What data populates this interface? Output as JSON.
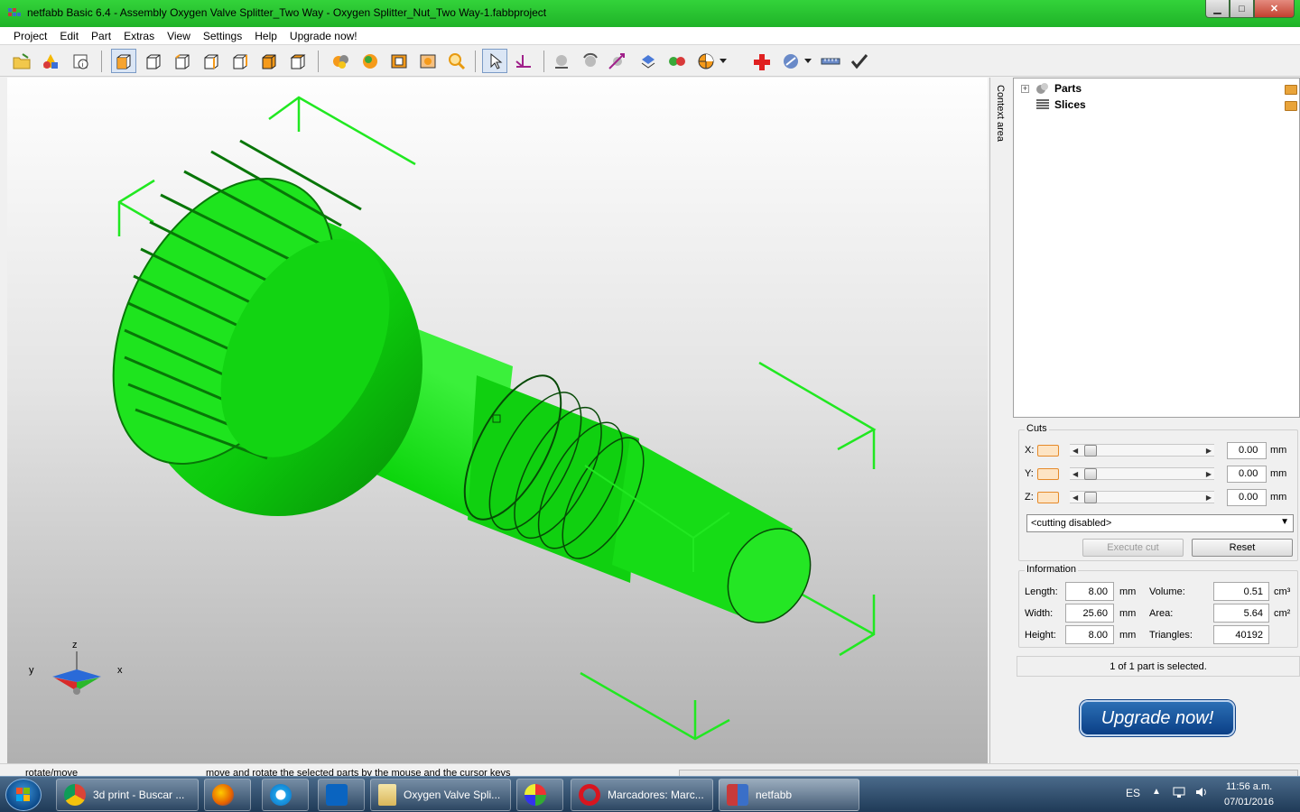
{
  "window": {
    "title": "netfabb Basic 6.4 - Assembly Oxygen Valve Splitter_Two Way - Oxygen Splitter_Nut_Two Way-1.fabbproject",
    "minimize": "▁",
    "maximize": "□",
    "close": "✕"
  },
  "menu": [
    "Project",
    "Edit",
    "Part",
    "Extras",
    "View",
    "Settings",
    "Help",
    "Upgrade now!"
  ],
  "toolbar_icons": [
    "open-project-icon",
    "add-part-icon",
    "project-info-icon",
    "view-default-icon",
    "view-front-icon",
    "view-back-icon",
    "view-left-icon",
    "view-right-icon",
    "view-top-icon",
    "view-bottom-icon",
    "repair-icon",
    "color-mode-icon",
    "wireframe-icon",
    "transparent-icon",
    "zoom-icon",
    "select-pointer-icon",
    "measure-icon",
    "sphere-icon",
    "rotate-icon",
    "scale-icon",
    "move-icon",
    "colors-icon",
    "section-icon",
    "add-icon",
    "analysis-icon",
    "ruler-icon",
    "checkmark-icon"
  ],
  "viewport": {
    "part_color": "#00d400",
    "bbox_color": "#21e821",
    "axis": {
      "x": "x",
      "y": "y",
      "z": "z"
    }
  },
  "context_strip_label": "Context area",
  "tree": {
    "items": [
      {
        "label": "Parts",
        "expand": "+"
      },
      {
        "label": "Slices"
      }
    ]
  },
  "cuts": {
    "title": "Cuts",
    "rows": [
      {
        "axis": "X:",
        "value": "0.00",
        "unit": "mm"
      },
      {
        "axis": "Y:",
        "value": "0.00",
        "unit": "mm"
      },
      {
        "axis": "Z:",
        "value": "0.00",
        "unit": "mm"
      }
    ],
    "mode": "<cutting disabled>",
    "execute_label": "Execute cut",
    "reset_label": "Reset"
  },
  "information": {
    "title": "Information",
    "length_label": "Length:",
    "length": "8.00",
    "length_unit": "mm",
    "width_label": "Width:",
    "width": "25.60",
    "width_unit": "mm",
    "height_label": "Height:",
    "height": "8.00",
    "height_unit": "mm",
    "volume_label": "Volume:",
    "volume": "0.51",
    "volume_unit": "cm³",
    "area_label": "Area:",
    "area": "5.64",
    "area_unit": "cm²",
    "triangles_label": "Triangles:",
    "triangles": "40192"
  },
  "selection_status": "1 of 1 part is selected.",
  "upgrade_button": "Upgrade now!",
  "status": {
    "mode": "rotate/move",
    "hint": "move and rotate the selected parts by the mouse and the cursor keys"
  },
  "taskbar": {
    "tasks": [
      {
        "label": "3d print - Buscar ..."
      },
      {
        "label": ""
      },
      {
        "label": ""
      },
      {
        "label": ""
      },
      {
        "label": "Oxygen Valve Spli..."
      },
      {
        "label": ""
      },
      {
        "label": "Marcadores: Marc..."
      },
      {
        "label": "netfabb"
      }
    ],
    "lang": "ES",
    "time": "11:56 a.m.",
    "date": "07/01/2016"
  }
}
